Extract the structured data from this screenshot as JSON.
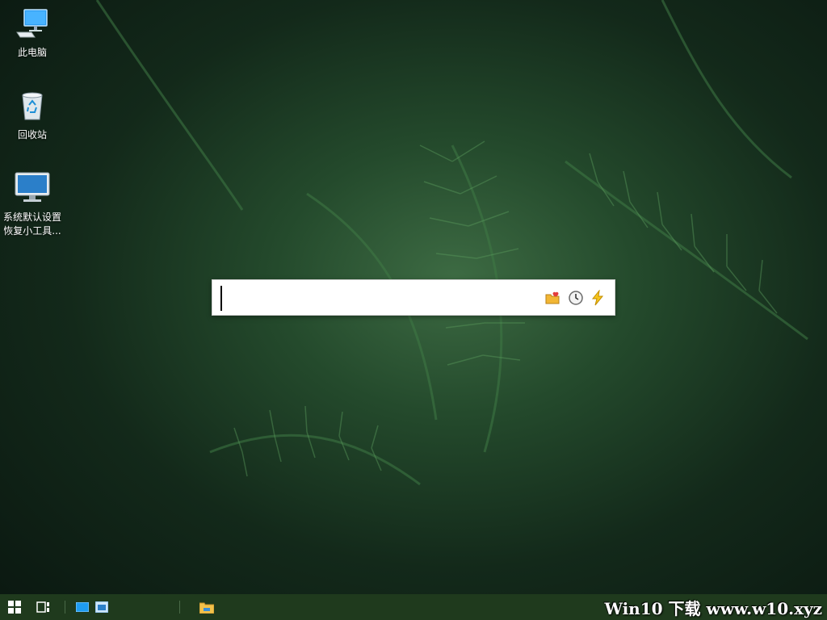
{
  "desktop": {
    "icons": [
      {
        "label": "此电脑"
      },
      {
        "label": "回收站"
      },
      {
        "label_line1": "系统默认设置",
        "label_line2": "恢复小工具..."
      }
    ]
  },
  "launcher": {
    "value": "",
    "tools": [
      "folder-heart-icon",
      "clock-icon",
      "lightning-icon"
    ]
  },
  "taskbar": {
    "watermark": "Win10 下载 www.w10.xyz",
    "color": "#1f3a1d"
  }
}
